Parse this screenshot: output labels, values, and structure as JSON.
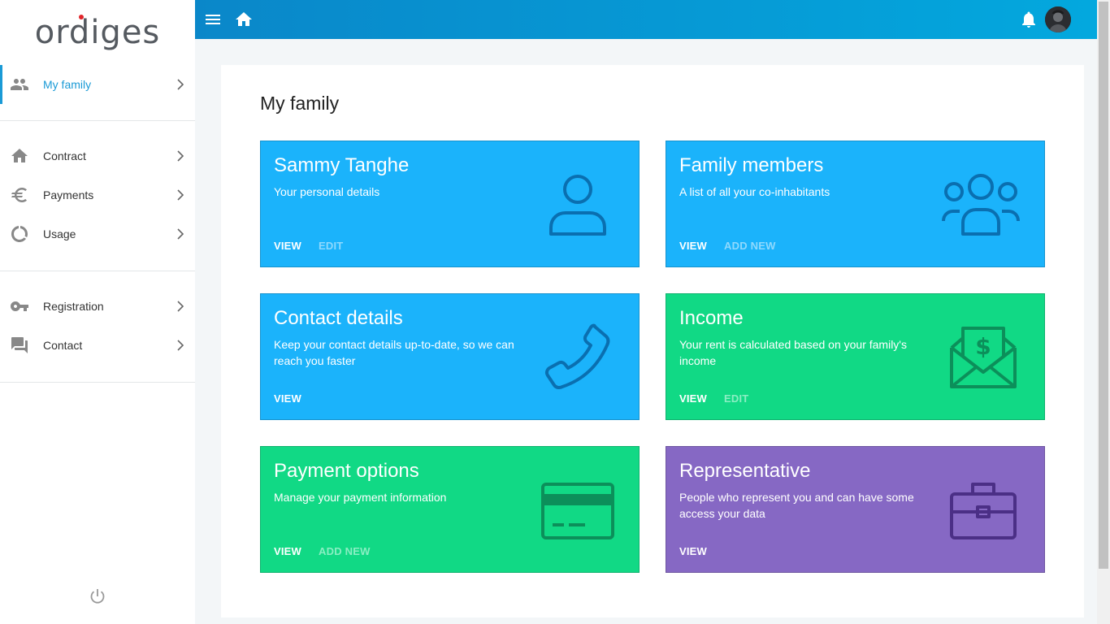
{
  "brand": {
    "logo_text": "rdiges",
    "logo_first": "o"
  },
  "sidebar": {
    "items": [
      {
        "label": "My family",
        "icon": "people-icon",
        "active": true
      },
      {
        "label": "Contract",
        "icon": "home-icon"
      },
      {
        "label": "Payments",
        "icon": "euro-icon"
      },
      {
        "label": "Usage",
        "icon": "donut-chart-icon"
      },
      {
        "label": "Registration",
        "icon": "key-icon"
      },
      {
        "label": "Contact",
        "icon": "chat-icon"
      }
    ],
    "footer_icon": "power-icon"
  },
  "topbar": {
    "icons": [
      "menu-icon",
      "home-icon",
      "bell-icon",
      "avatar"
    ]
  },
  "colors": {
    "accent": "#1a9ad6",
    "blue": "#1bb3fb",
    "green": "#11d985",
    "purple": "#8668c4",
    "topbar_start": "#0a87c9",
    "topbar_end": "#03a8de"
  },
  "page": {
    "title": "My family",
    "cards": [
      {
        "title": "Sammy Tanghe",
        "desc": "Your personal details",
        "actions": [
          "VIEW",
          "EDIT"
        ],
        "icon": "user-icon"
      },
      {
        "title": "Family members",
        "desc": "A list of all your co-inhabitants",
        "actions": [
          "VIEW",
          "ADD NEW"
        ],
        "icon": "group-icon"
      },
      {
        "title": "Contact details",
        "desc": "Keep your contact details up-to-date, so we can reach you faster",
        "actions": [
          "VIEW"
        ],
        "icon": "phone-icon"
      },
      {
        "title": "Income",
        "desc": "Your rent is calculated based on your family's income",
        "actions": [
          "VIEW",
          "EDIT"
        ],
        "icon": "money-envelope-icon"
      },
      {
        "title": "Payment options",
        "desc": "Manage your payment information",
        "actions": [
          "VIEW",
          "ADD NEW"
        ],
        "icon": "credit-card-icon"
      },
      {
        "title": "Representative",
        "desc": "People who represent you and can have some access your data",
        "actions": [
          "VIEW"
        ],
        "icon": "briefcase-icon"
      }
    ]
  }
}
